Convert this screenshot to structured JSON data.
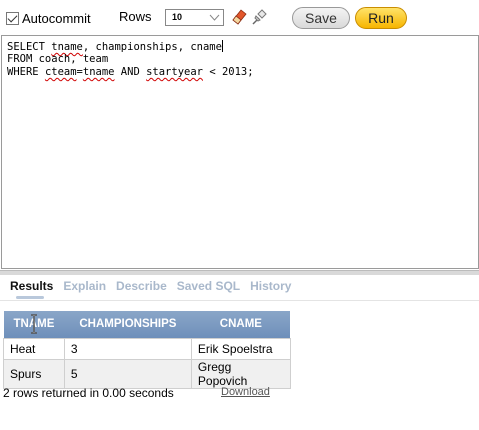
{
  "toolbar": {
    "autocommit_label": "Autocommit",
    "autocommit_checked": true,
    "rows_label": "Rows",
    "rows_value": "10",
    "eraser_icon": "eraser-icon",
    "pin_icon": "pushpin-icon",
    "save_label": "Save",
    "run_label": "Run"
  },
  "editor": {
    "lines": [
      "SELECT tname, championships, cname",
      "FROM coach, team",
      "WHERE cteam=tname AND startyear < 2013;"
    ]
  },
  "tabs": [
    "Results",
    "Explain",
    "Describe",
    "Saved SQL",
    "History"
  ],
  "active_tab": "Results",
  "results": {
    "columns": [
      "TNAME",
      "CHAMPIONSHIPS",
      "CNAME"
    ],
    "rows": [
      [
        "Heat",
        "3",
        "Erik Spoelstra"
      ],
      [
        "Spurs",
        "5",
        "Gregg Popovich"
      ]
    ],
    "summary": "2 rows returned in 0.00 seconds",
    "download_label": "Download"
  },
  "colors": {
    "run_button": "#f7b500",
    "header_bg": "#7b99c1",
    "tab_inactive": "#a9b8cb"
  }
}
